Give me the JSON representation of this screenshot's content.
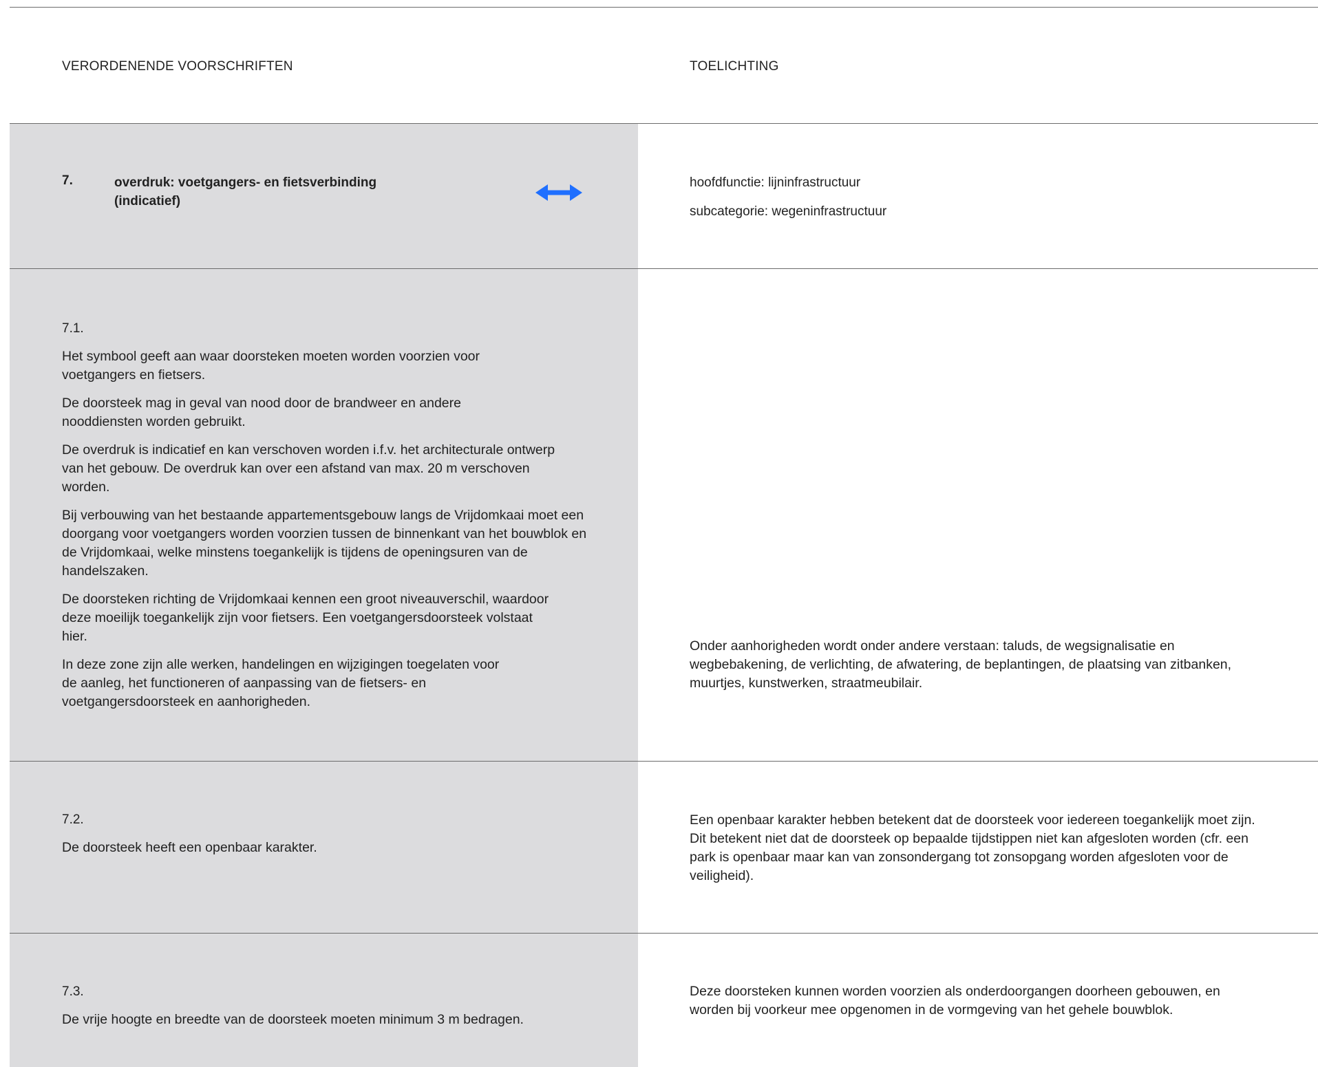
{
  "columns": {
    "left_label": "VERORDENENDE VOORSCHRIFTEN",
    "right_label": "TOELICHTING"
  },
  "section": {
    "number": "7.",
    "title_line1": "overdruk: voetgangers- en fietsverbinding",
    "title_line2": "(indicatief)",
    "symbol_icon": "double-arrow-horizontal-icon",
    "symbol_color": "#1f6fff",
    "hoofdfunctie": "hoofdfunctie: lijninfrastructuur",
    "subcategorie": "subcategorie: wegeninfrastructuur"
  },
  "colors": {
    "grey_panel": "#dcdcde",
    "rule_line": "#6b6b6b",
    "text": "#222222"
  },
  "articles": [
    {
      "number": "7.1.",
      "paragraphs": [
        "Het symbool geeft aan waar doorsteken moeten worden voorzien voor voetgangers en fietsers.",
        "De doorsteek mag in geval van nood door de brandweer en andere nooddiensten worden gebruikt.",
        "De overdruk is indicatief en kan verschoven worden i.f.v. het architecturale ontwerp van het gebouw. De overdruk kan over een afstand van max. 20 m verschoven worden.",
        "Bij verbouwing van het bestaande appartementsgebouw langs de Vrijdomkaai moet een doorgang voor voetgangers worden voorzien tussen de binnenkant van het bouwblok en de Vrijdomkaai, welke minstens toegankelijk is tijdens de openingsuren van de handelszaken.",
        "De doorsteken richting de Vrijdomkaai kennen een groot niveauverschil, waardoor deze moeilijk toegankelijk zijn voor fietsers. Een voetgangersdoorsteek volstaat hier.",
        "In deze zone zijn alle werken, handelingen en wijzigingen toegelaten voor de aanleg, het functioneren of aanpassing van de fietsers- en voetgangersdoorsteek en aanhorigheden."
      ],
      "toelichting": "Onder aanhorigheden wordt onder andere verstaan: taluds, de wegsignalisatie en wegbebakening, de verlichting, de afwatering, de beplantingen, de plaatsing van zitbanken, muurtjes, kunstwerken, straatmeubilair."
    },
    {
      "number": "7.2.",
      "paragraphs": [
        "De doorsteek heeft een openbaar karakter."
      ],
      "toelichting": "Een openbaar karakter hebben betekent dat de doorsteek voor iedereen toegankelijk moet zijn. Dit betekent niet dat de doorsteek op bepaalde tijdstippen niet kan afgesloten worden (cfr. een park is openbaar maar kan van zonsondergang tot zonsopgang worden afgesloten voor de veiligheid)."
    },
    {
      "number": "7.3.",
      "paragraphs": [
        "De vrije hoogte en breedte van de doorsteek moeten minimum 3 m bedragen."
      ],
      "toelichting": "Deze doorsteken kunnen worden voorzien als onderdoorgangen doorheen gebouwen, en worden bij voorkeur mee opgenomen in de vormgeving van het gehele bouwblok."
    }
  ]
}
